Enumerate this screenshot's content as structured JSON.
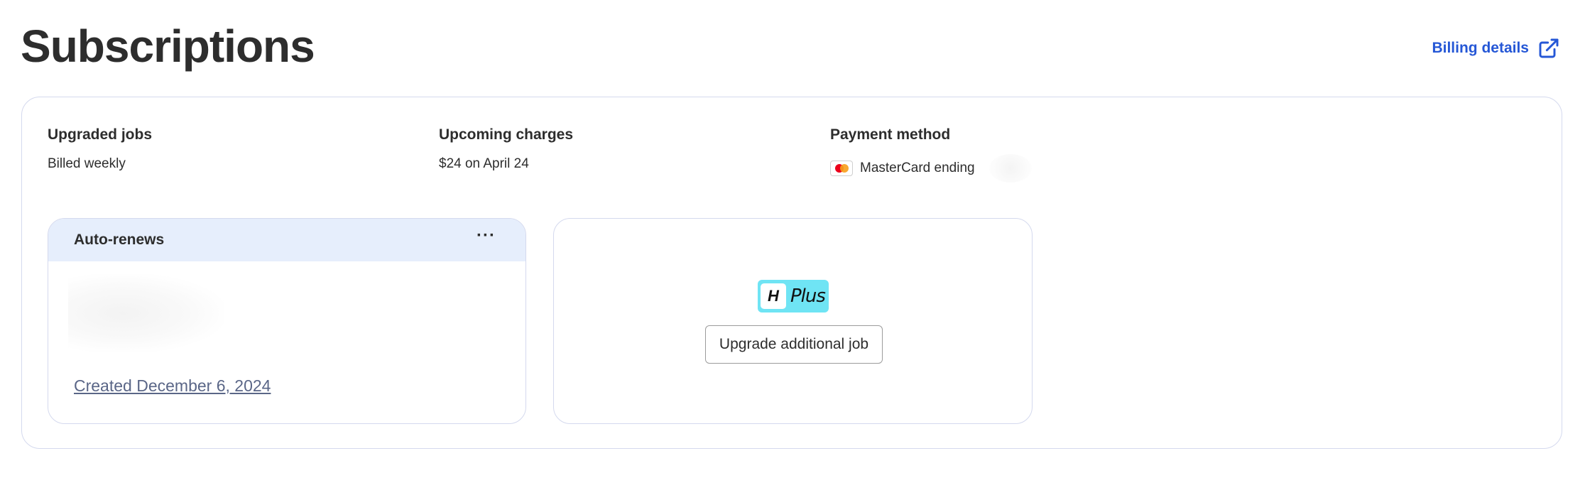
{
  "header": {
    "title": "Subscriptions",
    "billing_link_label": "Billing details"
  },
  "summary": {
    "upgraded_jobs": {
      "label": "Upgraded jobs",
      "value": "Billed weekly"
    },
    "upcoming_charges": {
      "label": "Upcoming charges",
      "value": "$24 on April 24"
    },
    "payment_method": {
      "label": "Payment method",
      "value": "MasterCard ending",
      "card_icon": "mastercard-icon"
    }
  },
  "job_card": {
    "status": "Auto-renews",
    "more_label": "···",
    "created_label": "Created December 6, 2024"
  },
  "upgrade_card": {
    "badge_h": "H",
    "badge_text": "Plus",
    "button_label": "Upgrade additional job"
  },
  "colors": {
    "link": "#2557d6",
    "card_border": "#d4d9ee",
    "card_header_bg": "#e6eefc",
    "badge_bg": "#6fe4f4"
  }
}
